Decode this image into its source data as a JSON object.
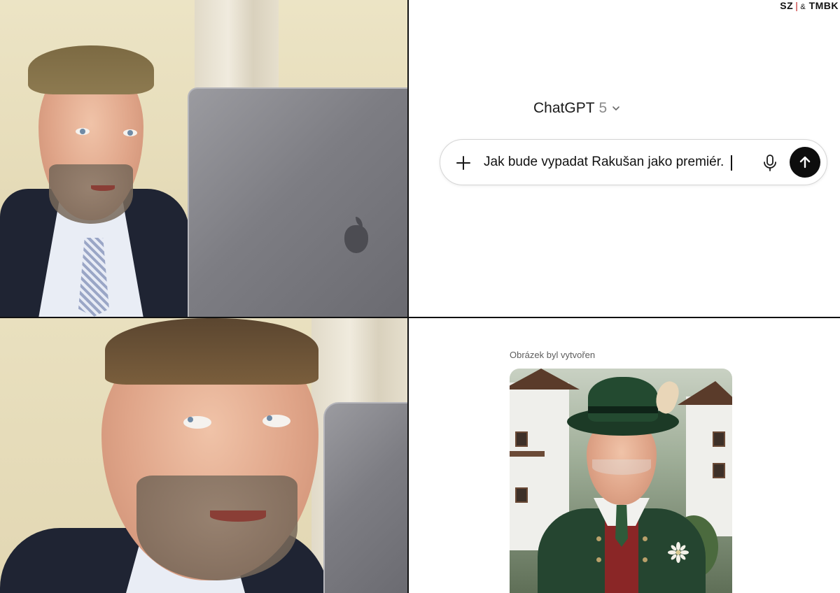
{
  "brand": {
    "left": "SZ",
    "separator": "|",
    "amp": "&",
    "right": "TMBK"
  },
  "chat": {
    "model_name": "ChatGPT",
    "model_version": "5",
    "prompt_text": "Jak bude vypadat Rakušan jako premiér.",
    "icons": {
      "add": "plus-icon",
      "model_dropdown": "chevron-down-icon",
      "voice": "microphone-icon",
      "send": "arrow-up-icon"
    }
  },
  "result": {
    "caption": "Obrázek byl vytvořen"
  },
  "colors": {
    "send_button": "#0d0d0d",
    "composer_border": "#d5d5d5",
    "brand_accent": "#c21d1d"
  }
}
